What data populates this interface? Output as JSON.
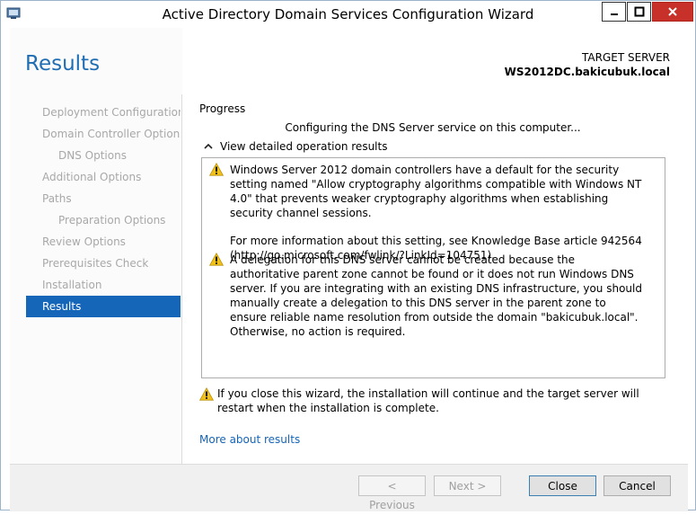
{
  "window": {
    "title": "Active Directory Domain Services Configuration Wizard"
  },
  "header": {
    "page_title": "Results",
    "target_label": "TARGET SERVER",
    "target_server": "WS2012DC.bakicubuk.local"
  },
  "sidebar": {
    "items": [
      {
        "label": "Deployment Configuration",
        "sub": false,
        "active": false
      },
      {
        "label": "Domain Controller Options",
        "sub": false,
        "active": false
      },
      {
        "label": "DNS Options",
        "sub": true,
        "active": false
      },
      {
        "label": "Additional Options",
        "sub": false,
        "active": false
      },
      {
        "label": "Paths",
        "sub": false,
        "active": false
      },
      {
        "label": "Preparation Options",
        "sub": true,
        "active": false
      },
      {
        "label": "Review Options",
        "sub": false,
        "active": false
      },
      {
        "label": "Prerequisites Check",
        "sub": false,
        "active": false
      },
      {
        "label": "Installation",
        "sub": false,
        "active": false
      },
      {
        "label": "Results",
        "sub": false,
        "active": true
      }
    ]
  },
  "main": {
    "progress_label": "Progress",
    "progress_status": "Configuring the DNS Server service on this computer...",
    "details_toggle": "View detailed operation results",
    "results": [
      {
        "p1": "Windows Server 2012 domain controllers have a default for the security setting named \"Allow cryptography algorithms compatible with Windows NT 4.0\" that prevents weaker cryptography algorithms when establishing security channel sessions.",
        "p2": "For more information about this setting, see Knowledge Base article 942564 (http://go.microsoft.com/fwlink/?LinkId=104751)."
      },
      {
        "p1": "A delegation for this DNS server cannot be created because the authoritative parent zone cannot be found or it does not run Windows DNS server. If you are integrating with an existing DNS infrastructure, you should manually create a delegation to this DNS server in the parent zone to ensure reliable name resolution from outside the domain \"bakicubuk.local\". Otherwise, no action is required."
      }
    ],
    "footer_warning": "If you close this wizard, the installation will continue and the target server will restart when the installation is complete.",
    "more_link": "More about results"
  },
  "buttons": {
    "previous": "< Previous",
    "next": "Next >",
    "close": "Close",
    "cancel": "Cancel"
  },
  "colors": {
    "accent": "#1565b9",
    "title_blue": "#1f6db3",
    "close_red": "#c7312a",
    "warning_yellow": "#f2c21b"
  },
  "icons": {
    "app": "server-manager-icon",
    "warning": "warning-icon",
    "chevron": "chevron-up-icon"
  }
}
